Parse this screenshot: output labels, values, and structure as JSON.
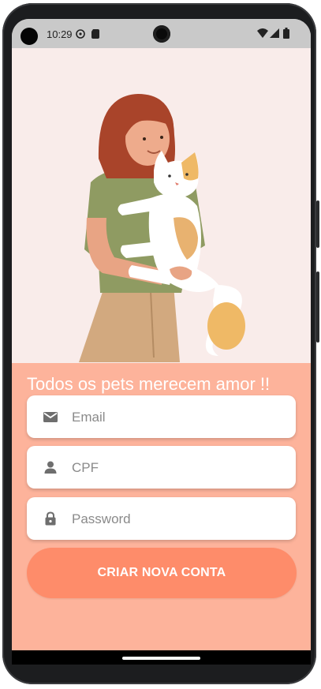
{
  "status_bar": {
    "time": "10:29",
    "left_icons": [
      "settings-icon",
      "sim-card-icon"
    ],
    "right_icons": [
      "wifi-icon",
      "signal-icon",
      "battery-icon"
    ]
  },
  "hero": {
    "illustration": "woman-holding-cat-illustration"
  },
  "form": {
    "tagline": "Todos os pets merecem amor !!",
    "fields": [
      {
        "icon": "email-icon",
        "placeholder": "Email",
        "value": ""
      },
      {
        "icon": "person-icon",
        "placeholder": "CPF",
        "value": ""
      },
      {
        "icon": "lock-icon",
        "placeholder": "Password",
        "value": ""
      }
    ],
    "submit_label": "CRIAR NOVA CONTA"
  },
  "colors": {
    "hero_bg": "#f9ecea",
    "panel_bg": "#fdb39b",
    "button_bg": "#fe8c6a",
    "status_bar_bg": "#c9c9c9"
  }
}
